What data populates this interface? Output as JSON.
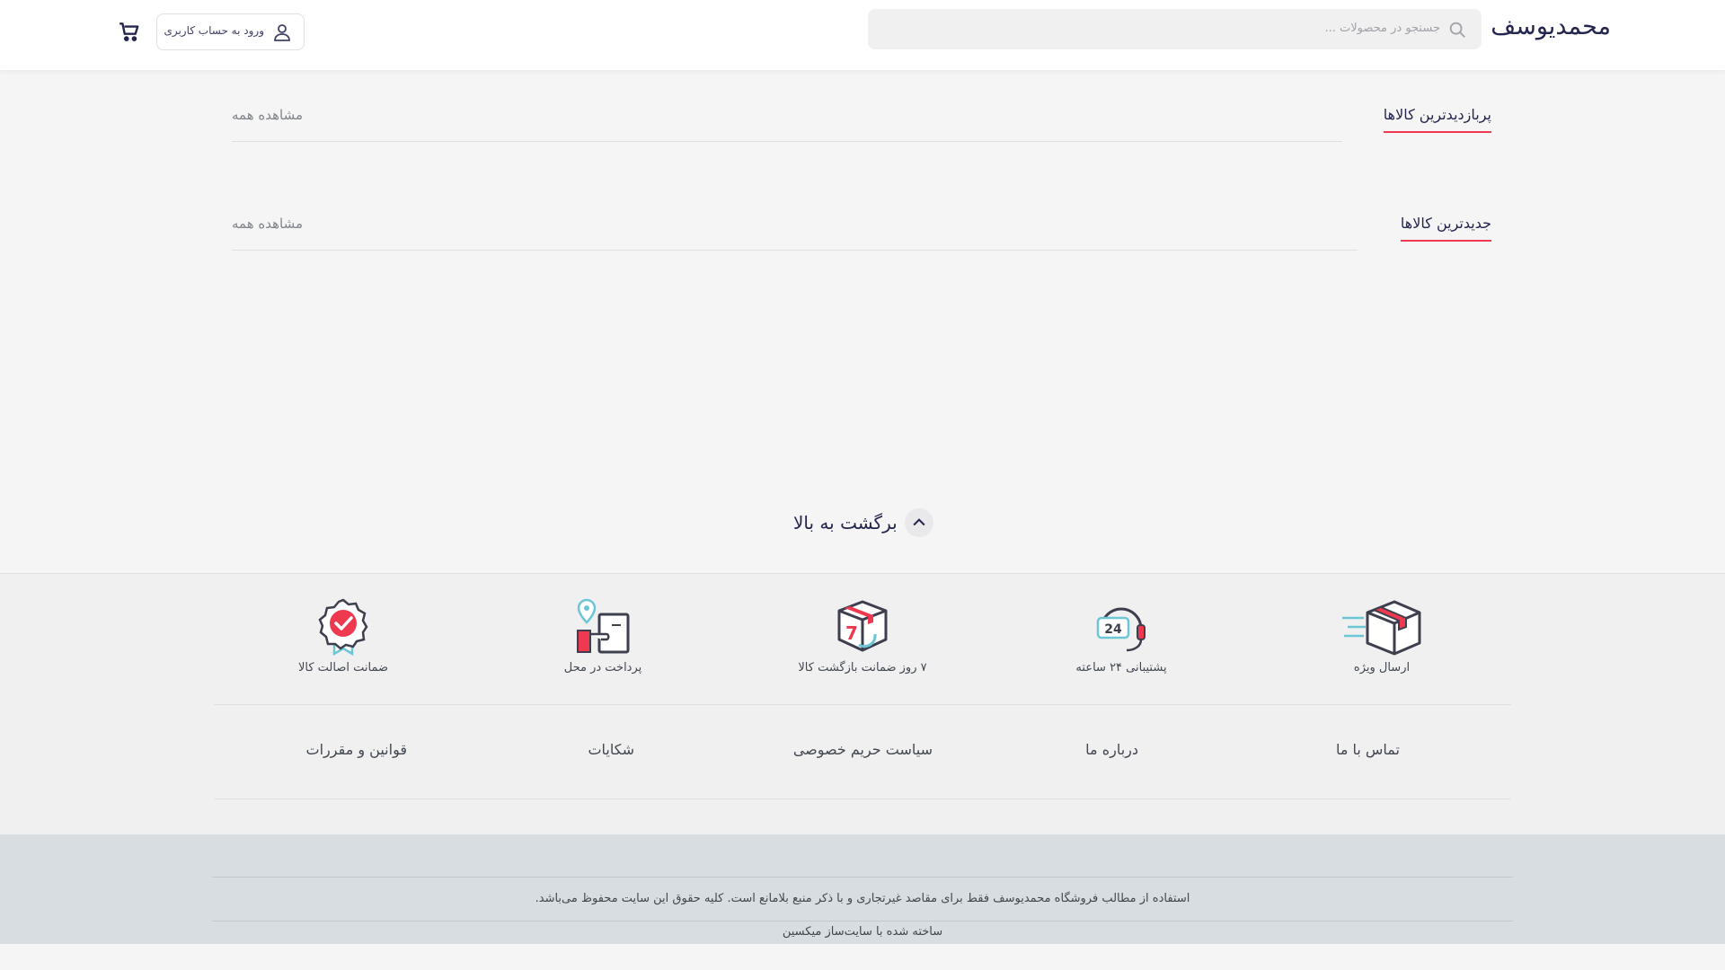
{
  "header": {
    "logo": "محمدیوسف",
    "search_placeholder": "جستجو در محصولات ...",
    "login_label": "ورود به حساب کاربری"
  },
  "sections": [
    {
      "title": "پربازدیدترین کالاها",
      "view_all": "مشاهده همه"
    },
    {
      "title": "جدیدترین کالاها",
      "view_all": "مشاهده همه"
    }
  ],
  "back_to_top": "برگشت به بالا",
  "services": [
    {
      "label": "ارسال ویژه",
      "icon": "delivery-box-icon"
    },
    {
      "label": "پشتیبانی ۲۴ ساعته",
      "icon": "support-24-icon"
    },
    {
      "label": "۷ روز ضمانت بازگشت کالا",
      "icon": "return-7-days-icon"
    },
    {
      "label": "پرداخت در محل",
      "icon": "cash-on-delivery-icon"
    },
    {
      "label": "ضمانت اصالت کالا",
      "icon": "authenticity-badge-icon"
    }
  ],
  "footer_links": [
    "تماس با ما",
    "درباره ما",
    "سیاست حریم خصوصی",
    "شکایات",
    "قوانین و مقررات"
  ],
  "copyright": "استفاده از مطالب فروشگاه محمدیوسف فقط برای مقاصد غیرتجاری و با ذکر منبع بلامانع است. کلیه حقوق این سایت محفوظ می‌باشد.",
  "built_with": "ساخته شده با سایت‌ساز میکسین",
  "colors": {
    "accent": "#ef394e",
    "title": "#23254e",
    "text": "#424750",
    "muted": "#81858b"
  }
}
